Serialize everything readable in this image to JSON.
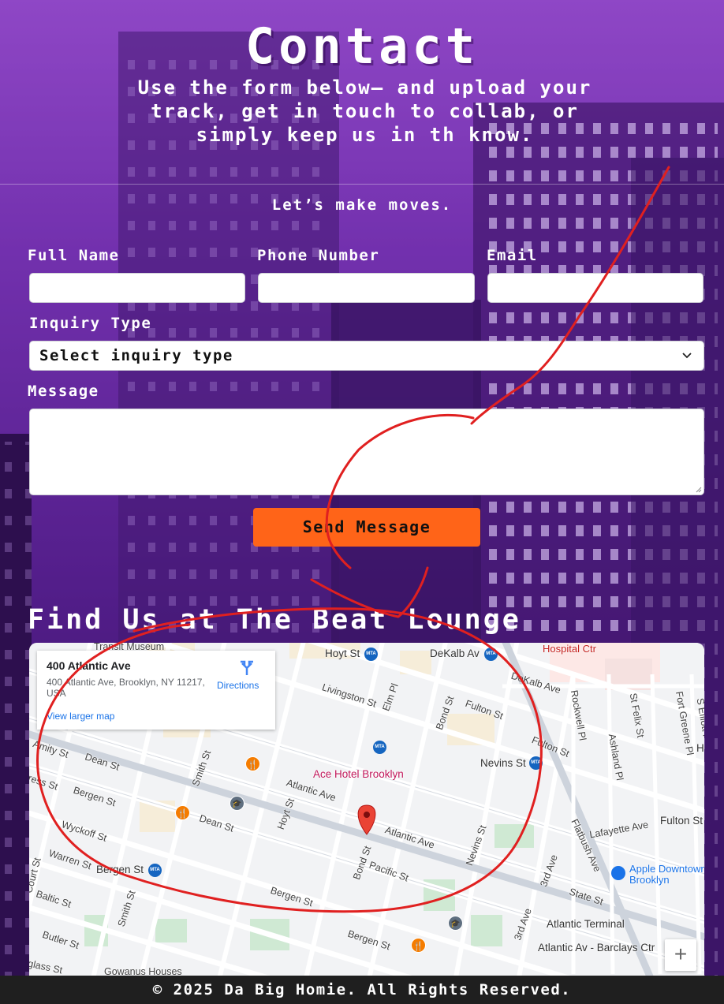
{
  "page": {
    "title": "Contact",
    "subtitle": "Use the form below— and upload your track, get in touch to collab, or simply keep us in th know.",
    "tagline": "Let’s make moves."
  },
  "form": {
    "full_name": {
      "label": "Full Name",
      "value": "",
      "placeholder": ""
    },
    "phone": {
      "label": "Phone Number",
      "value": "",
      "placeholder": ""
    },
    "email": {
      "label": "Email",
      "value": "",
      "placeholder": ""
    },
    "inquiry": {
      "label": "Inquiry Type",
      "selected": "Select inquiry type"
    },
    "message": {
      "label": "Message",
      "value": ""
    },
    "submit_label": "Send Message"
  },
  "map_section": {
    "title": "Find Us at The Beat Lounge",
    "card": {
      "name": "400 Atlantic Ave",
      "address": "400 Atlantic Ave, Brooklyn, NY 11217, USA",
      "directions": "Directions",
      "larger_map": "View larger map"
    },
    "zoom_in": "+",
    "labels": {
      "transit_museum": "Transit Museum",
      "hoyt_st": "Hoyt St",
      "dekalb_av_station": "DeKalb Av",
      "hospital_ctr": "Hospital Ctr",
      "dekalb_ave": "DeKalb Ave",
      "livingston_st": "Livingston St",
      "elm_pl": "Elm Pl",
      "bond_st_n": "Bond St",
      "fulton_st_1": "Fulton St",
      "fulton_st_2": "Fulton St",
      "rockwell_pl": "Rockwell Pl",
      "st_felix_st": "St Felix St",
      "fort_greene_pl": "Fort Greene Pl",
      "s_elliott": "S Elliott P",
      "ashland_pl": "Ashland Pl",
      "amity_st": "Amity St",
      "dean_st_1": "Dean St",
      "smith_st_1": "Smith St",
      "ace_hotel": "Ace Hotel Brooklyn",
      "nevins_st_station": "Nevins St",
      "ress_st": "ress St",
      "bergen_st_1": "Bergen St",
      "atlantic_ave_1": "Atlantic Ave",
      "hoyt_st_2": "Hoyt St",
      "dean_st_2": "Dean St",
      "fulton_st_3": "Fulton St",
      "lafayette_ave": "Lafayette Ave",
      "wyckoff_st": "Wyckoff St",
      "atlantic_ave_2": "Atlantic Ave",
      "nevins_st": "Nevins St",
      "flatbush_ave": "Flatbush Ave",
      "warren_st": "Warren St",
      "bergen_st_station": "Bergen St",
      "bond_st_s": "Bond St",
      "pacific_st": "Pacific St",
      "third_ave_1": "3rd Ave",
      "apple_store": "Apple Downtown Brooklyn",
      "court_st": "Court St",
      "baltic_st": "Baltic St",
      "bergen_st_2": "Bergen St",
      "state_st": "State St",
      "smith_st_2": "Smith St",
      "atlantic_terminal": "Atlantic Terminal",
      "third_ave_2": "3rd Ave",
      "butler_st": "Butler St",
      "bergen_st_3": "Bergen St",
      "atlantic_barclays": "Atlantic Av - Barclays Ctr",
      "douglass_st": "glass St",
      "gowanus_houses": "Gowanus Houses",
      "h_edge": "H"
    }
  },
  "footer": {
    "text": "© 2025 Da Big Homie. All Rights Reserved."
  },
  "colors": {
    "accent_button": "#ff6418",
    "background_purple": "#5a2390",
    "annotation_red": "#e02020",
    "footer_bg": "#1f1f1f"
  }
}
